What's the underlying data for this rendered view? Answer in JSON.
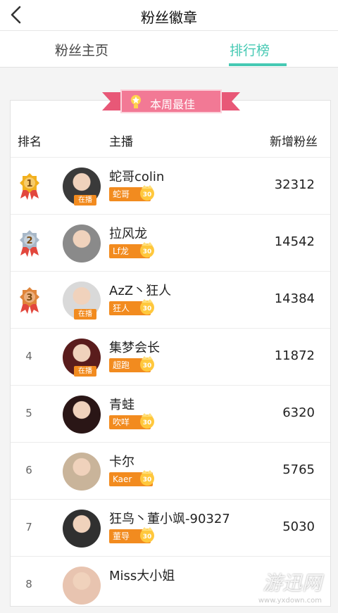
{
  "header": {
    "title": "粉丝徽章"
  },
  "tabs": [
    {
      "label": "粉丝主页",
      "active": false
    },
    {
      "label": "排行榜",
      "active": true
    }
  ],
  "banner": {
    "label": "本周最佳"
  },
  "columns": {
    "rank": "排名",
    "anchor": "主播",
    "fans": "新增粉丝"
  },
  "live_label": "在播",
  "rows": [
    {
      "rank": "1",
      "name": "蛇哥colin",
      "tag": "蛇哥",
      "fans": "32312",
      "live": true,
      "medal": "gold",
      "avatar_color": "#3a3a3a"
    },
    {
      "rank": "2",
      "name": "拉风龙",
      "tag": "Lf龙",
      "fans": "14542",
      "live": false,
      "medal": "silver",
      "avatar_color": "#8a8a8a"
    },
    {
      "rank": "3",
      "name": "AzZ丶狂人",
      "tag": "狂人",
      "fans": "14384",
      "live": true,
      "medal": "bronze",
      "avatar_color": "#d9d9d9"
    },
    {
      "rank": "4",
      "name": "集梦会长",
      "tag": "超跑",
      "fans": "11872",
      "live": true,
      "medal": "",
      "avatar_color": "#5a1c1c"
    },
    {
      "rank": "5",
      "name": "青蛙",
      "tag": "吹咩",
      "fans": "6320",
      "live": false,
      "medal": "",
      "avatar_color": "#2a1616"
    },
    {
      "rank": "6",
      "name": "卡尔",
      "tag": "Kaer",
      "fans": "5765",
      "live": false,
      "medal": "",
      "avatar_color": "#c9b49a"
    },
    {
      "rank": "7",
      "name": "狂鸟丶董小飒-90327",
      "tag": "董导",
      "fans": "5030",
      "live": false,
      "medal": "",
      "avatar_color": "#303030"
    },
    {
      "rank": "8",
      "name": "Miss大小姐",
      "tag": "",
      "fans": "",
      "live": false,
      "medal": "",
      "avatar_color": "#e8c4b0"
    }
  ],
  "watermark": {
    "text": "游迅网",
    "sub": "www.yxdown.com"
  },
  "colors": {
    "accent": "#46c9b3",
    "tag_orange": "#f28b1f",
    "ribbon_pink": "#f27995",
    "gold": "#f2b01e",
    "silver": "#a8b8c8",
    "bronze": "#e0853a"
  }
}
